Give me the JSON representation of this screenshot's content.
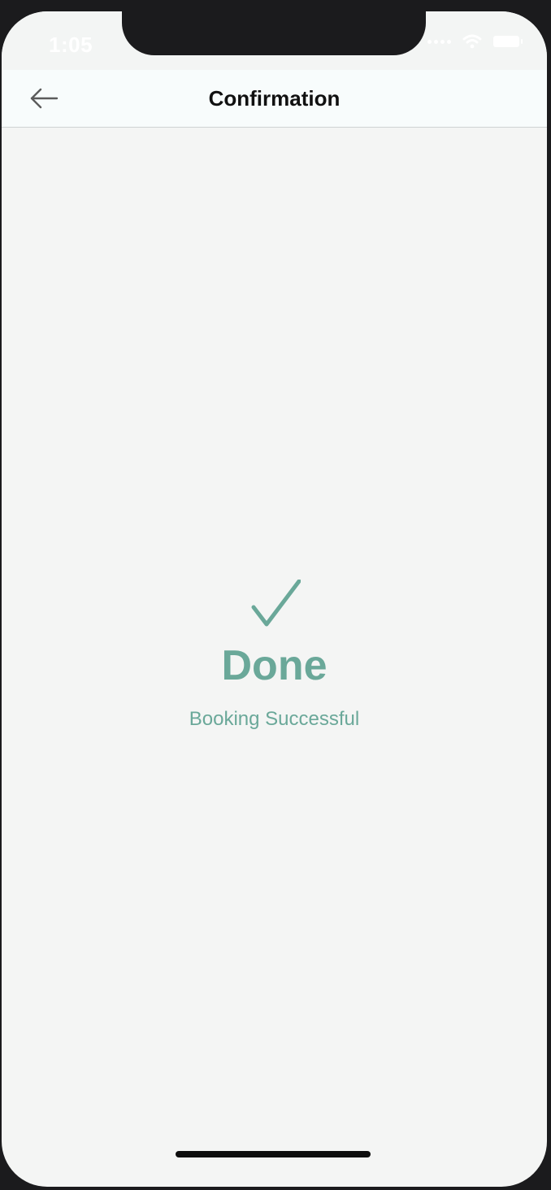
{
  "status_bar": {
    "time": "1:05"
  },
  "nav": {
    "title": "Confirmation",
    "back_icon": "arrow-left-icon"
  },
  "confirmation": {
    "icon": "check-icon",
    "headline": "Done",
    "message": "Booking Successful",
    "accent_color": "#6aa899"
  }
}
